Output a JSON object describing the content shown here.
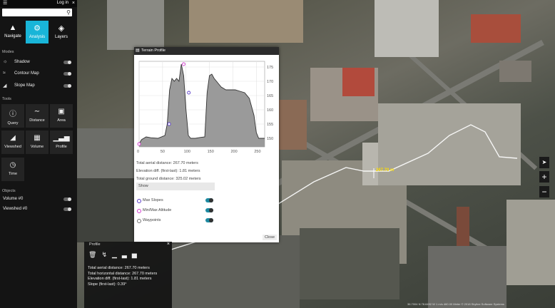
{
  "topbar": {
    "login": "Log in"
  },
  "search": {
    "placeholder": ""
  },
  "modes_tabs": [
    {
      "label": "Navigate",
      "icon": "navigate-icon"
    },
    {
      "label": "Analysis",
      "icon": "analysis-icon",
      "active": true
    },
    {
      "label": "Layers",
      "icon": "layers-icon"
    }
  ],
  "modes": {
    "title": "Modes",
    "items": [
      {
        "label": "Shadow",
        "icon": "shadow-icon"
      },
      {
        "label": "Contour Map",
        "icon": "contour-icon"
      },
      {
        "label": "Slope Map",
        "icon": "slope-icon"
      }
    ]
  },
  "tools": {
    "title": "Tools",
    "items": [
      {
        "label": "Query",
        "icon": "query-icon"
      },
      {
        "label": "Distance",
        "icon": "distance-icon"
      },
      {
        "label": "Area",
        "icon": "area-icon"
      },
      {
        "label": "Viewshed",
        "icon": "viewshed-icon"
      },
      {
        "label": "Volume",
        "icon": "volume-icon"
      },
      {
        "label": "Profile",
        "icon": "profile-icon"
      },
      {
        "label": "Time",
        "icon": "time-icon"
      }
    ]
  },
  "objects": {
    "title": "Objects",
    "items": [
      {
        "label": "Volume #0"
      },
      {
        "label": "Viewshed #0"
      }
    ]
  },
  "terrain_profile": {
    "title": "Terrain Profile",
    "stats": [
      "Total aerial distance: 267.70 meters",
      "Elevation diff. (first-last): 1.81 meters",
      "Total ground distance: 325.02 meters"
    ],
    "show_title": "Show",
    "options": [
      {
        "label": "Max Slopes",
        "color": "#5a3cc8"
      },
      {
        "label": "Min/Max Altitude",
        "color": "#d23ccf"
      },
      {
        "label": "Waypoints",
        "color": "#777777"
      }
    ],
    "close": "Close"
  },
  "chart_data": {
    "type": "area",
    "x": [
      0,
      5,
      15,
      25,
      40,
      55,
      60,
      65,
      70,
      75,
      80,
      85,
      90,
      95,
      100,
      105,
      110,
      120,
      130,
      140,
      145,
      150,
      155,
      160,
      165,
      175,
      185,
      195,
      205,
      215,
      225,
      235,
      245,
      250,
      255,
      260,
      267.7
    ],
    "y": [
      148,
      149.5,
      150.5,
      150.2,
      150,
      151,
      155,
      167,
      171,
      170,
      171,
      170,
      176,
      172,
      160,
      151,
      150,
      150,
      150.3,
      150.5,
      166,
      172,
      172.5,
      171,
      170,
      168,
      167,
      167,
      167,
      166.5,
      166,
      164,
      158,
      152,
      150,
      150,
      150
    ],
    "xticks": [
      0,
      50,
      100,
      150,
      200,
      250
    ],
    "yticks": [
      150,
      155,
      160,
      165,
      170,
      175
    ],
    "xlim": [
      0,
      267.7
    ],
    "ylim": [
      147,
      177
    ],
    "markers": [
      {
        "x": 0,
        "y": 148,
        "kind": "min"
      },
      {
        "x": 95,
        "y": 176,
        "kind": "max"
      },
      {
        "x": 64,
        "y": 155,
        "kind": "slope"
      },
      {
        "x": 106,
        "y": 166,
        "kind": "slope"
      }
    ],
    "grid": true
  },
  "profile_panel": {
    "title": "Profile",
    "stats": [
      "Total aerial distance: 267.70 meters",
      "Total horizontal distance: 267.70 meters",
      "Elevation diff. (first-last): 1.81 meters",
      "Slope (first-last): 0.39°"
    ]
  },
  "map": {
    "distance_label": "267.70 m",
    "footer": "36.7004 N   78.6492 W   1 m/s   460.00 Meter   © 2018 Skyline Software Systems"
  }
}
